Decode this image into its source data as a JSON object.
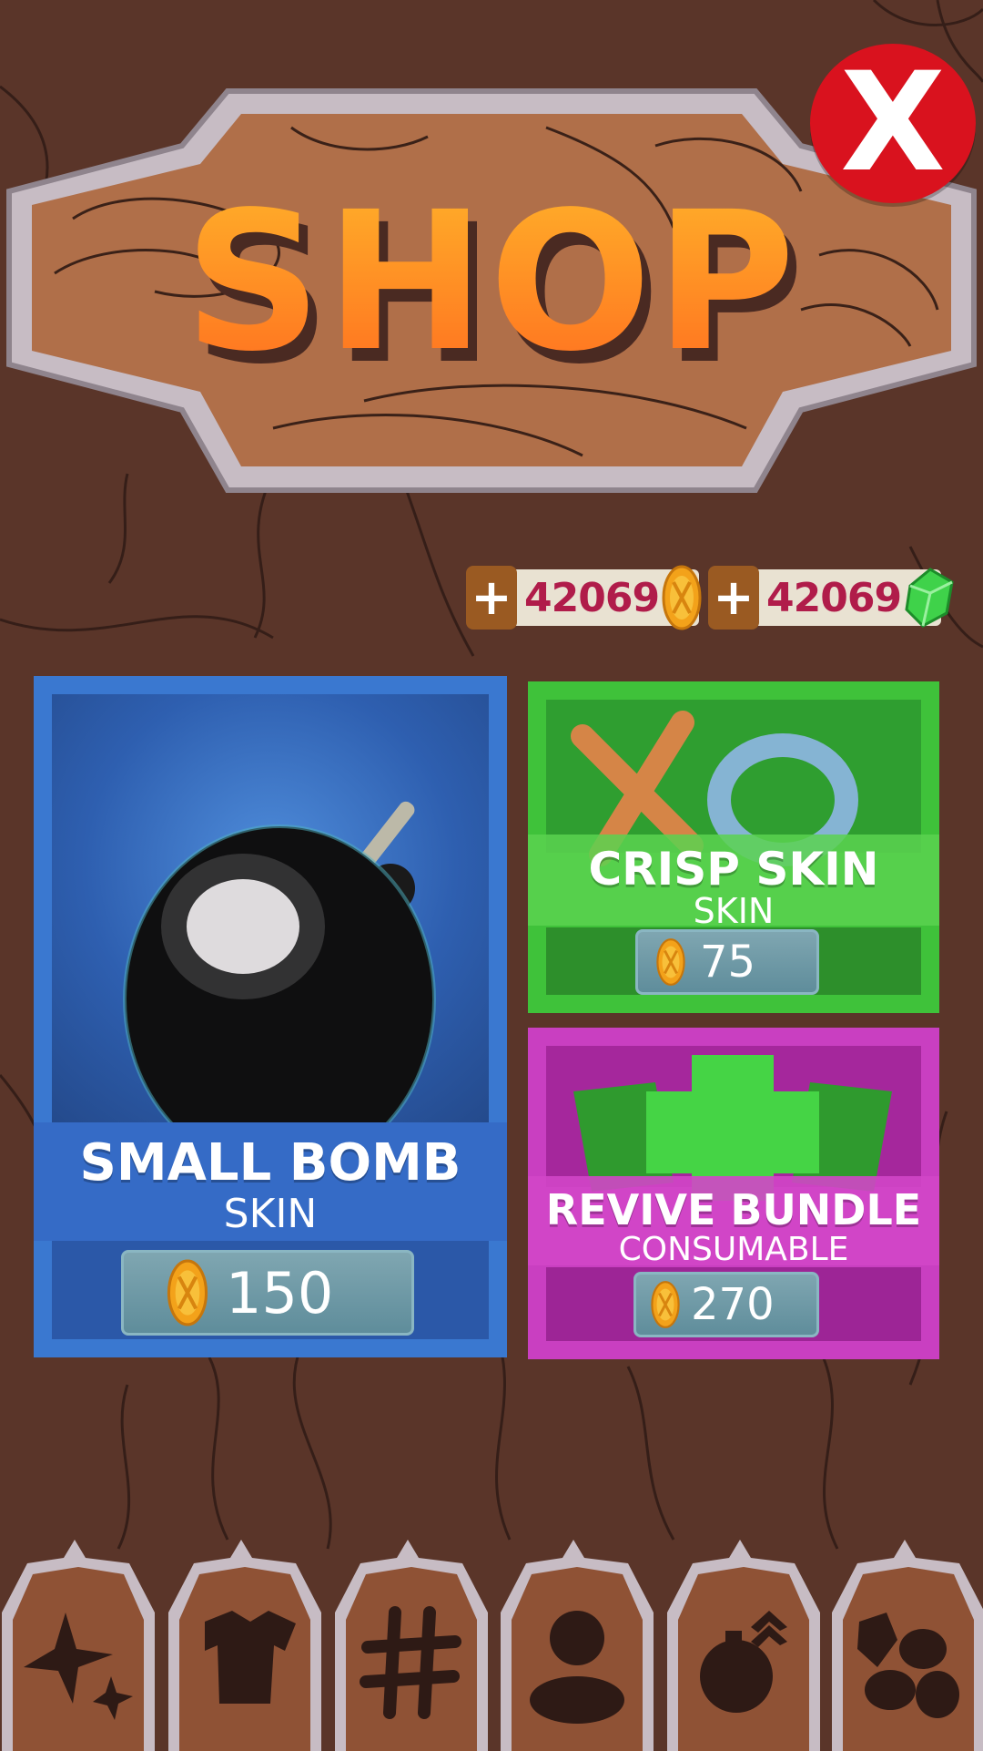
{
  "header": {
    "title": "SHOP",
    "close_label": "X"
  },
  "currencies": [
    {
      "name": "coins",
      "amount": "42069",
      "plus": "+",
      "icon": "coin-icon"
    },
    {
      "name": "gems",
      "amount": "42069",
      "plus": "+",
      "icon": "gem-icon"
    }
  ],
  "items": [
    {
      "name": "SMALL BOMB",
      "type": "SKIN",
      "price": "150",
      "color": "#3a78d0"
    },
    {
      "name": "CRISP SKIN",
      "type": "SKIN",
      "price": "75",
      "color": "#3fc23a"
    },
    {
      "name": "REVIVE BUNDLE",
      "type": "CONSUMABLE",
      "price": "270",
      "color": "#c93fc1"
    }
  ],
  "tabs": [
    {
      "icon": "stars-icon"
    },
    {
      "icon": "shirt-icon"
    },
    {
      "icon": "tic-tac-toe-icon"
    },
    {
      "icon": "avatar-icon"
    },
    {
      "icon": "bomb-rank-icon"
    },
    {
      "icon": "coins-gems-icon"
    }
  ],
  "colors": {
    "background": "#5a3529",
    "sign_wood": "#b06f49",
    "currency_text": "#b01c4a"
  }
}
